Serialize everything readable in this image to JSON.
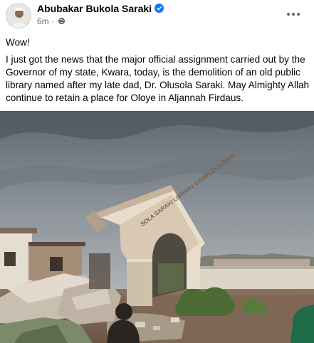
{
  "post": {
    "author": "Abubakar Bukola Saraki",
    "time": "6m",
    "separator": "·",
    "line1": "Wow!",
    "body": "I just got the news that the major official assignment carried out by the Governor of my state, Kwara, today, is the demolition of an old public library named after my late dad, Dr. Olusola Saraki. May Almighty Allah continue to retain a place for Oloye in Aljannah Firdaus."
  },
  "photo": {
    "sign_text": "SOLA SARAKI LIBRARY COMPLEX ILORIN"
  },
  "colors": {
    "verified": "#1877f2",
    "meta": "#65676b",
    "text": "#050505"
  },
  "icons": [
    "verified-badge-icon",
    "globe-icon",
    "more-options-icon"
  ]
}
